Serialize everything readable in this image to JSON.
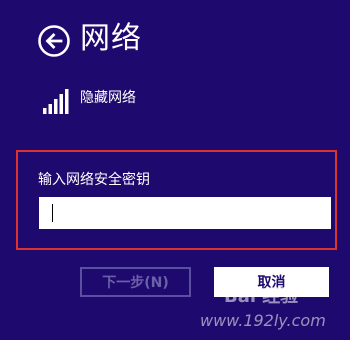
{
  "header": {
    "back_icon": "back-arrow-icon",
    "title": "网络"
  },
  "network": {
    "signal_icon": "wifi-signal-icon",
    "name": "隐藏网络"
  },
  "security_key": {
    "label": "输入网络安全密钥",
    "value": "",
    "placeholder": ""
  },
  "buttons": {
    "next_label": "下一步(N)",
    "cancel_label": "取消"
  },
  "watermark": {
    "logo_text": "Bai 经验",
    "url": "www.192ly.com"
  },
  "colors": {
    "background": "#1e0a6e",
    "highlight_border": "#e0322c",
    "text": "#ffffff",
    "disabled_text": "#6b61a8"
  }
}
